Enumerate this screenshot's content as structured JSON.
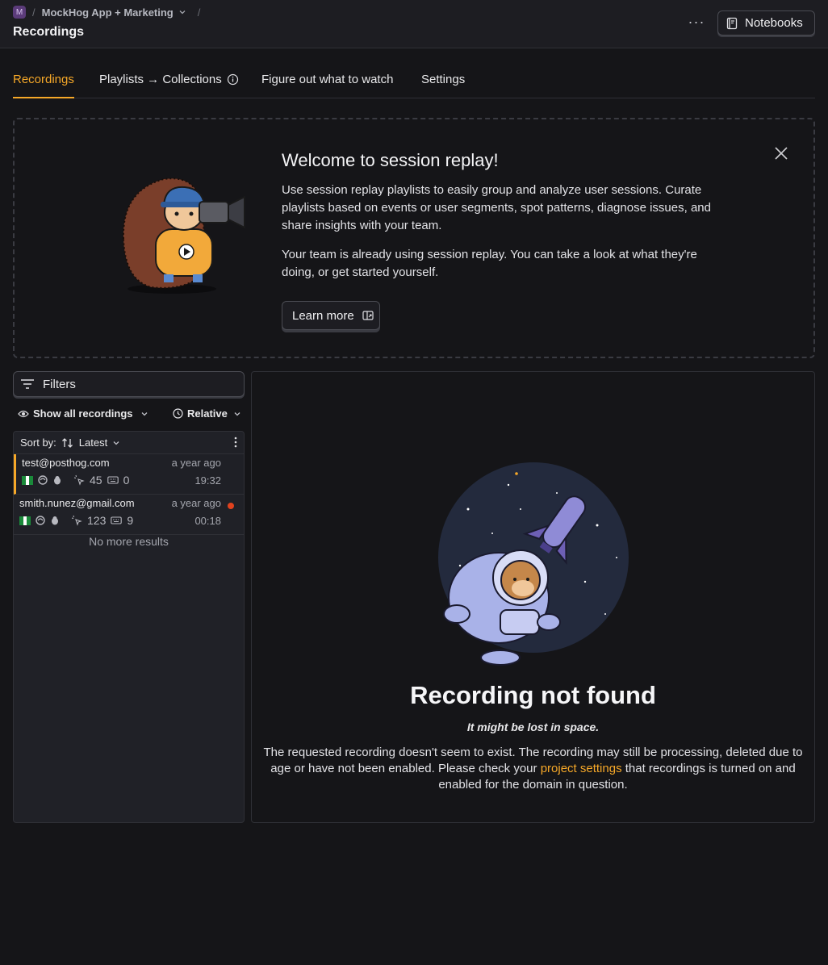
{
  "header": {
    "project_initial": "M",
    "project_name": "MockHog App + Marketing",
    "page_title": "Recordings",
    "more_label": "···",
    "notebooks_label": "Notebooks"
  },
  "tabs": [
    {
      "label": "Recordings",
      "active": true
    },
    {
      "label": "Playlists → Collections"
    },
    {
      "label": "Figure out what to watch"
    },
    {
      "label": "Settings"
    }
  ],
  "welcome": {
    "title": "Welcome to session replay!",
    "paragraph1": "Use session replay playlists to easily group and analyze user sessions. Curate playlists based on events or user segments, spot patterns, diagnose issues, and share insights with your team.",
    "paragraph2": "Your team is already using session replay. You can take a look at what they're doing, or get started yourself.",
    "learn_more": "Learn more"
  },
  "filters": {
    "label": "Filters",
    "show_all": "Show all recordings",
    "relative": "Relative",
    "sort_label": "Sort by:",
    "sort_value": "Latest"
  },
  "recordings": [
    {
      "email": "test@posthog.com",
      "ago": "a year ago",
      "clicks": "45",
      "keys": "0",
      "duration": "19:32",
      "active": true
    },
    {
      "email": "smith.nunez@gmail.com",
      "ago": "a year ago",
      "clicks": "123",
      "keys": "9",
      "duration": "00:18",
      "live": true
    }
  ],
  "no_more": "No more results",
  "not_found": {
    "title": "Recording not found",
    "subtitle": "It might be lost in space.",
    "desc_before": "The requested recording doesn't seem to exist. The recording may still be processing, deleted due to age or have not been enabled. Please check your ",
    "desc_link": "project settings",
    "desc_after": " that recordings is turned on and enabled for the domain in question."
  },
  "colors": {
    "accent": "#f6a828",
    "background": "#151518",
    "live_dot": "#e0421e"
  }
}
